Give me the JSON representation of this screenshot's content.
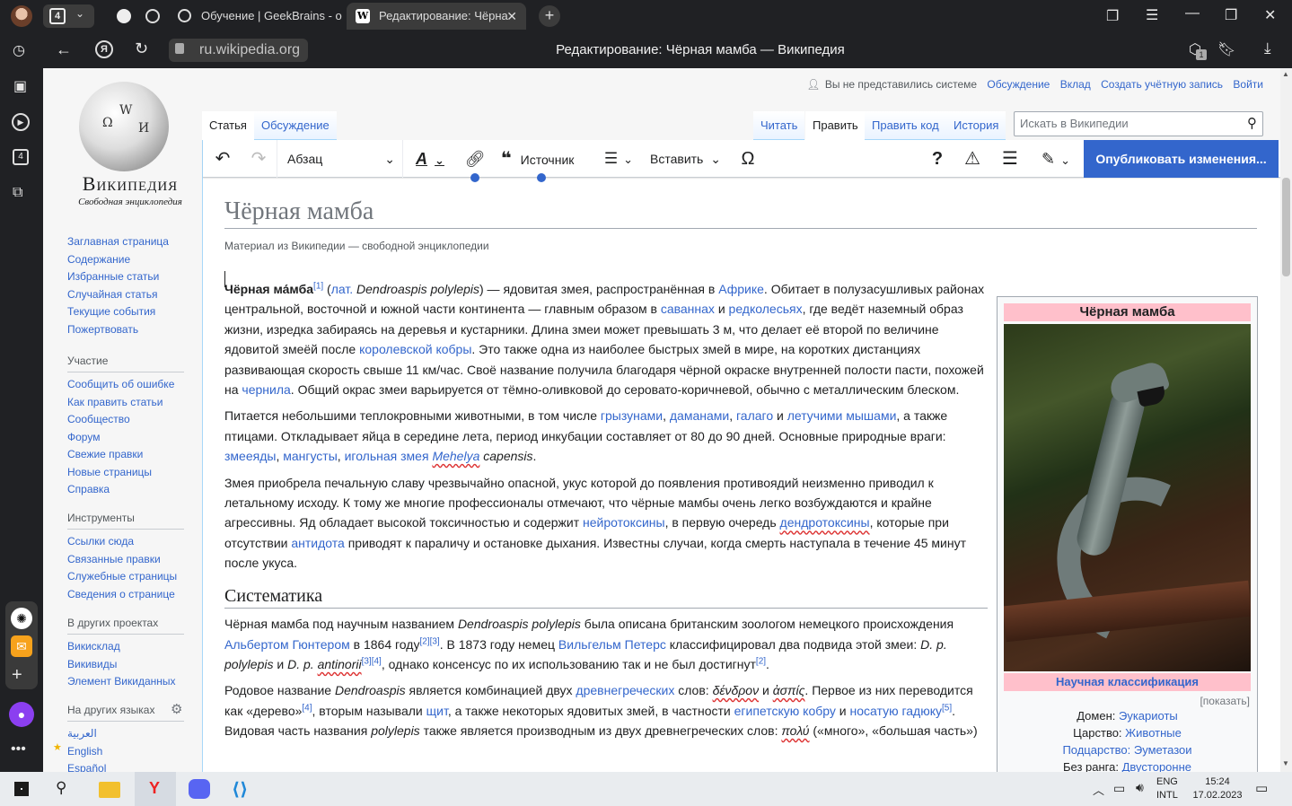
{
  "browser": {
    "tab_count": "4",
    "tabs": [
      {
        "title": "Обучение | GeekBrains - о"
      },
      {
        "title": "Редактирование: Чёрна"
      }
    ],
    "url": "ru.wikipedia.org",
    "window_title": "Редактирование: Чёрная мамба — Википедия",
    "badge_count": "1"
  },
  "logo": {
    "name": "Википедия",
    "tagline": "Свободная энциклопедия"
  },
  "sidebar": {
    "main": [
      "Заглавная страница",
      "Содержание",
      "Избранные статьи",
      "Случайная статья",
      "Текущие события",
      "Пожертвовать"
    ],
    "participation": {
      "heading": "Участие",
      "items": [
        "Сообщить об ошибке",
        "Как править статьи",
        "Сообщество",
        "Форум",
        "Свежие правки",
        "Новые страницы",
        "Справка"
      ]
    },
    "tools": {
      "heading": "Инструменты",
      "items": [
        "Ссылки сюда",
        "Связанные правки",
        "Служебные страницы",
        "Сведения о странице"
      ]
    },
    "projects": {
      "heading": "В других проектах",
      "items": [
        "Викисклад",
        "Викивиды",
        "Элемент Викиданных"
      ]
    },
    "languages": {
      "heading": "На других языках",
      "items": [
        "العربية",
        "English",
        "Español"
      ]
    }
  },
  "personal": {
    "not_logged": "Вы не представились системе",
    "talk": "Обсуждение",
    "contrib": "Вклад",
    "create": "Создать учётную запись",
    "login": "Войти"
  },
  "tabs": {
    "article": "Статья",
    "talk": "Обсуждение",
    "read": "Читать",
    "edit": "Править",
    "edit_source": "Править код",
    "history": "История"
  },
  "search": {
    "placeholder": "Искать в Википедии"
  },
  "toolbar": {
    "format": "Абзац",
    "cite": "Источник",
    "insert": "Вставить",
    "publish": "Опубликовать изменения..."
  },
  "article": {
    "title": "Чёрная мамба",
    "tagline": "Материал из Википедии — свободной энциклопедии",
    "section_title": "Систематика"
  },
  "infobox": {
    "title": "Чёрная мамба",
    "classification": "Научная классификация",
    "show": "[показать]",
    "rows": [
      {
        "label": "Домен:",
        "value": "Эукариоты"
      },
      {
        "label": "Царство:",
        "value": "Животные"
      },
      {
        "label": "Подцарство:",
        "value": "Эуметазои"
      },
      {
        "label": "Без ранга:",
        "value": "Двусторонне"
      }
    ]
  },
  "taskbar": {
    "lang1": "ENG",
    "lang2": "INTL",
    "time": "15:24",
    "date": "17.02.2023"
  }
}
